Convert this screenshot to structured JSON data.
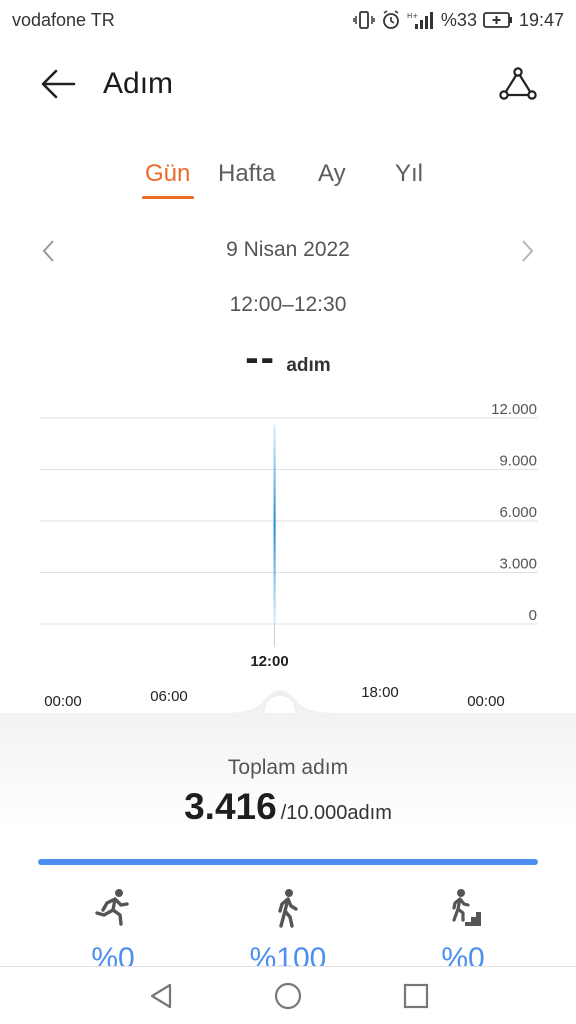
{
  "status_bar": {
    "carrier": "vodafone TR",
    "battery_percent": "%33",
    "time": "19:47",
    "icons": [
      "vibrate-icon",
      "alarm-icon",
      "signal-icon",
      "battery-charging-icon"
    ]
  },
  "header": {
    "title": "Adım",
    "back_icon": "arrow-left-icon",
    "share_icon": "share-icon"
  },
  "tabs": [
    {
      "label": "Gün",
      "active": true
    },
    {
      "label": "Hafta",
      "active": false
    },
    {
      "label": "Ay",
      "active": false
    },
    {
      "label": "Yıl",
      "active": false
    }
  ],
  "date_nav": {
    "date": "9 Nisan 2022",
    "time_range": "12:00–12:30",
    "prev_icon": "chevron-left-icon",
    "next_icon": "chevron-right-icon"
  },
  "selected_value": {
    "value": "--",
    "unit": "adım"
  },
  "chart_data": {
    "type": "bar",
    "y_ticks": [
      "12.000",
      "9.000",
      "6.000",
      "3.000",
      "0"
    ],
    "ylim": [
      0,
      12000
    ],
    "x_ticks": [
      "00:00",
      "06:00",
      "18:00",
      "00:00"
    ],
    "selected_x_label": "12:00",
    "grid": true,
    "series": [
      {
        "x": "12:00",
        "y": 11600
      }
    ],
    "colors": {
      "bar": "#2f93d8",
      "grid": "#e2e2e2",
      "text": "#555555"
    }
  },
  "summary": {
    "title": "Toplam adım",
    "total": "3.416",
    "goal": "/10.000adım",
    "progress_fraction": 1.0
  },
  "activities": [
    {
      "icon": "running-icon",
      "value": "%0"
    },
    {
      "icon": "walking-icon",
      "value": "%100"
    },
    {
      "icon": "climbing-stairs-icon",
      "value": "%0"
    }
  ],
  "nav_bar": {
    "icons": [
      "back-triangle-icon",
      "home-circle-icon",
      "recents-square-icon"
    ]
  },
  "colors": {
    "accent": "#ea6a2c",
    "progress": "#4d8ff1"
  }
}
